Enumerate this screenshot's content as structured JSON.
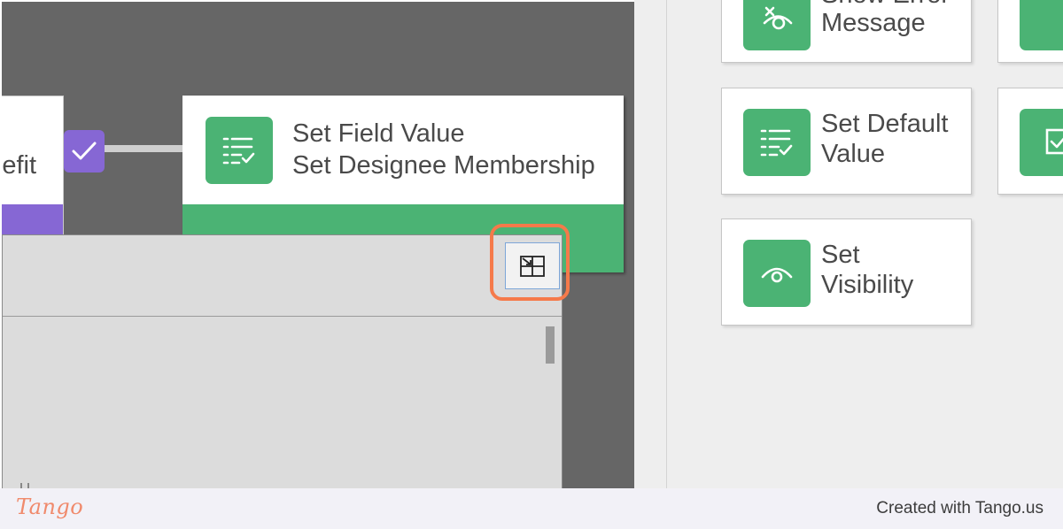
{
  "canvas": {
    "previous_node_label": "efit",
    "node": {
      "title": "Set Field Value",
      "subtitle": "Set Designee Membership"
    }
  },
  "sidebar": {
    "tiles": [
      {
        "label_line1": "Show Error",
        "label_line2": "Message",
        "icon": "error-hide-icon"
      },
      {
        "label_line1": "Set Default",
        "label_line2": "Value",
        "icon": "list-check-icon"
      },
      {
        "label_line1": "Set",
        "label_line2": "Visibility",
        "icon": "eye-icon"
      }
    ]
  },
  "footer": {
    "brand": "Tango",
    "credit": "Created with Tango.us"
  },
  "colors": {
    "green": "#4bb374",
    "purple": "#8667d4",
    "highlight": "#f57a4a"
  }
}
